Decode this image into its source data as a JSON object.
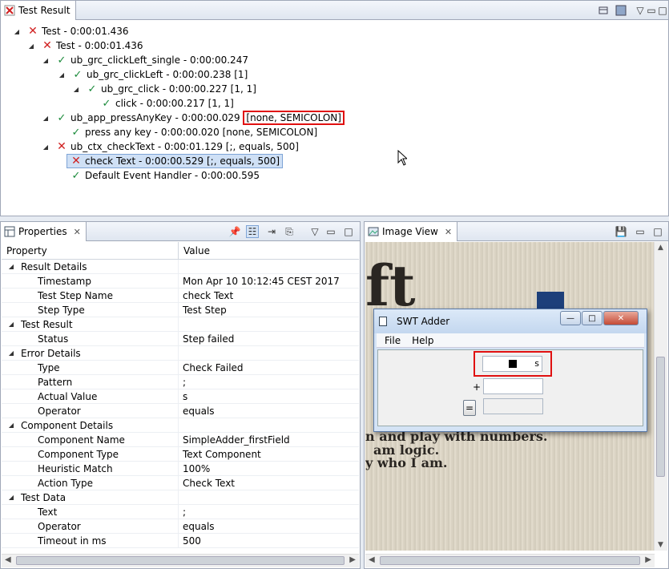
{
  "test_result": {
    "tab_label": "Test Result",
    "rows": [
      {
        "text": "Test - 0:00:01.436",
        "status": "fail"
      },
      {
        "text": "Test - 0:00:01.436",
        "status": "fail"
      },
      {
        "text": "ub_grc_clickLeft_single - 0:00:00.247",
        "status": "pass"
      },
      {
        "text": "ub_grc_clickLeft - 0:00:00.238 [1]",
        "status": "pass"
      },
      {
        "text": "ub_grc_click - 0:00:00.227 [1, 1]",
        "status": "pass"
      },
      {
        "text": "click - 0:00:00.217 [1, 1]",
        "status": "pass"
      },
      {
        "text": "ub_app_pressAnyKey - 0:00:00.029",
        "highlight": "[none, SEMICOLON]",
        "status": "pass"
      },
      {
        "text": "press any key - 0:00:00.020 [none, SEMICOLON]",
        "status": "pass"
      },
      {
        "text": "ub_ctx_checkText - 0:00:01.129 [;, equals, 500]",
        "status": "fail"
      },
      {
        "text": "check Text - 0:00:00.529 [;, equals, 500]",
        "status": "fail"
      },
      {
        "text": "Default Event Handler - 0:00:00.595",
        "status": "pass"
      }
    ]
  },
  "properties": {
    "tab_label": "Properties",
    "col_property": "Property",
    "col_value": "Value",
    "groups": [
      {
        "name": "Result Details",
        "items": [
          {
            "k": "Timestamp",
            "v": "Mon Apr 10 10:12:45 CEST 2017"
          },
          {
            "k": "Test Step Name",
            "v": "check Text"
          },
          {
            "k": "Step Type",
            "v": "Test Step"
          }
        ]
      },
      {
        "name": "Test Result",
        "items": [
          {
            "k": "Status",
            "v": "Step failed"
          }
        ]
      },
      {
        "name": "Error Details",
        "items": [
          {
            "k": "Type",
            "v": "Check Failed"
          },
          {
            "k": "Pattern",
            "v": ";"
          },
          {
            "k": "Actual Value",
            "v": "s"
          },
          {
            "k": "Operator",
            "v": "equals"
          }
        ]
      },
      {
        "name": "Component Details",
        "items": [
          {
            "k": "Component Name",
            "v": "SimpleAdder_firstField"
          },
          {
            "k": "Component Type",
            "v": "Text Component"
          },
          {
            "k": "Heuristic Match",
            "v": "100%"
          },
          {
            "k": "Action Type",
            "v": "Check Text"
          }
        ]
      },
      {
        "name": "Test Data",
        "items": [
          {
            "k": "Text",
            "v": ";"
          },
          {
            "k": "Operator",
            "v": "equals"
          },
          {
            "k": "Timeout in ms",
            "v": "500"
          }
        ]
      }
    ]
  },
  "image_view": {
    "tab_label": "Image View",
    "bg_text_top": "ft",
    "bg_text_lines": [
      "am logic.",
      "y who I am."
    ],
    "bg_text_partial": "n and play with numbers.",
    "dialog": {
      "title": "SWT Adder",
      "menu": [
        "File",
        "Help"
      ],
      "field1_value": "s",
      "plus": "+",
      "equals_button": "="
    }
  }
}
